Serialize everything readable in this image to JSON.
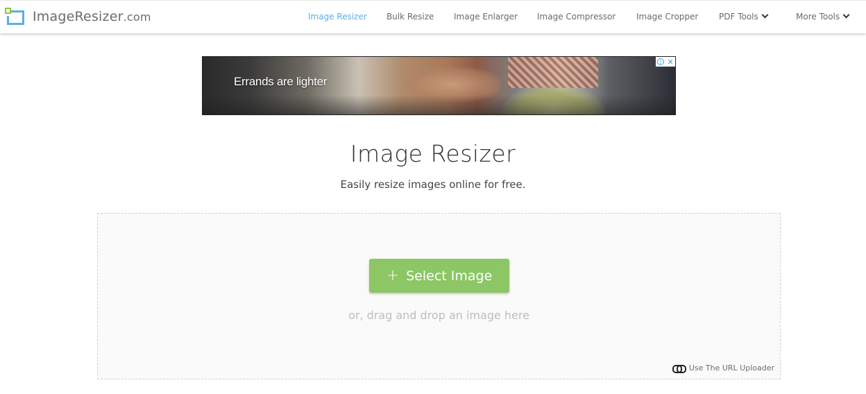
{
  "header": {
    "logo": {
      "name": "ImageResizer",
      "domain": ".com"
    },
    "nav": [
      {
        "label": "Image Resizer",
        "active": true
      },
      {
        "label": "Bulk Resize",
        "active": false
      },
      {
        "label": "Image Enlarger",
        "active": false
      },
      {
        "label": "Image Compressor",
        "active": false
      },
      {
        "label": "Image Cropper",
        "active": false
      },
      {
        "label": "PDF Tools",
        "active": false,
        "dropdown": true
      },
      {
        "label": "More Tools",
        "active": false,
        "dropdown": true
      }
    ]
  },
  "ad": {
    "text": "Errands are lighter",
    "info_icon": "info-icon",
    "close_icon": "close-icon",
    "info_glyph": "i",
    "close_glyph": "✕"
  },
  "main": {
    "title": "Image Resizer",
    "subtitle": "Easily resize images online for free.",
    "dropzone": {
      "button_label": "Select Image",
      "button_icon": "+",
      "drag_text": "or, drag and drop an image here",
      "url_link": "Use The URL Uploader"
    }
  },
  "colors": {
    "accent_blue": "#5aaee5",
    "accent_green": "#8cc665",
    "logo_green": "#8cc63f"
  }
}
